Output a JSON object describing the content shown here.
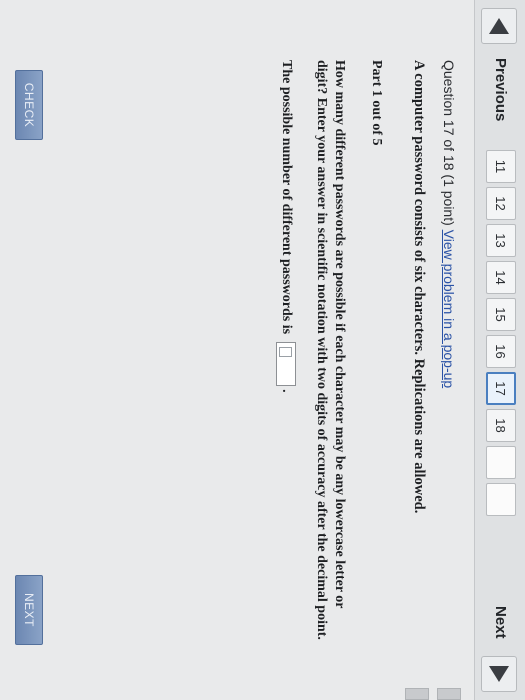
{
  "nav": {
    "previous_label": "Previous",
    "next_label": "Next",
    "tabs": [
      "11",
      "12",
      "13",
      "14",
      "15",
      "16",
      "17",
      "18",
      "",
      ""
    ],
    "current_tab": "17"
  },
  "question": {
    "header_prefix": "Question 17 of 18 (1 point)",
    "popup_link": "View problem in a pop-up",
    "statement": "A computer password consists of six characters. Replications are allowed.",
    "part": "Part 1 out of 5",
    "prompt": "How many different passwords are possible if each character may be any lowercase letter or digit? Enter your answer in scientific notation with two digits of accuracy after the decimal point.",
    "answer_label": "The possible number of different passwords is",
    "answer_value": "",
    "period": "."
  },
  "buttons": {
    "check_label": "CHECK",
    "next_label": "NEXT"
  },
  "colors": {
    "link": "#2a52a6",
    "button": "#6c87b2",
    "current_tab_border": "#4a7fc0"
  }
}
